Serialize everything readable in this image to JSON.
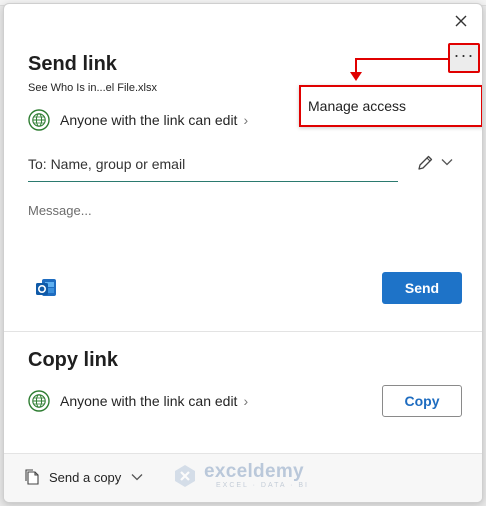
{
  "dialog": {
    "send_title": "Send link",
    "filename": "See Who Is in...el File.xlsx",
    "permission": "Anyone with the link can edit",
    "to_placeholder": "To: Name, group or email",
    "message_placeholder": "Message...",
    "send_label": "Send",
    "copy_title": "Copy link",
    "copy_permission": "Anyone with the link can edit",
    "copy_label": "Copy",
    "more_label": "···",
    "close_icon": "close-icon"
  },
  "menu": {
    "manage_access": "Manage access"
  },
  "footer": {
    "send_copy_label": "Send a copy"
  },
  "watermark": {
    "name": "exceldemy",
    "tagline": "EXCEL · DATA · BI"
  },
  "colors": {
    "accent": "#1e73c8",
    "annotation": "#e00000",
    "field_underline": "#2b7a6f",
    "globe": "#2e7d32"
  }
}
